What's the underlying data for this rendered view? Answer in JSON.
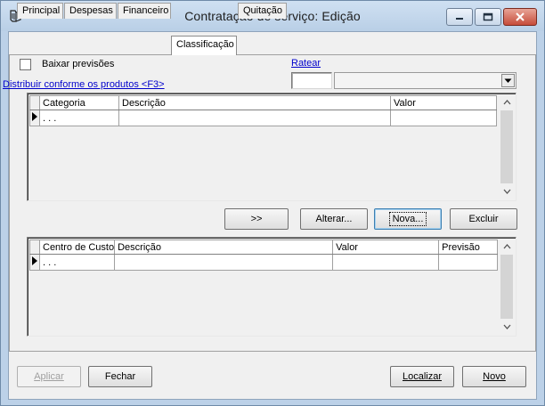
{
  "window": {
    "title": "Contratação de serviço: Edição"
  },
  "tabs": [
    {
      "label": "Principal",
      "active": false
    },
    {
      "label": "Despesas",
      "active": false
    },
    {
      "label": "Financeiro",
      "active": false
    },
    {
      "label": "Classificação",
      "active": true
    },
    {
      "label": "Quitação",
      "active": false
    }
  ],
  "classificacao": {
    "baixar_previsoes_label": "Baixar previsões",
    "baixar_previsoes_checked": false,
    "ratear_link": "Ratear",
    "distribuir_link": "Distribuir conforme os produtos <F3>",
    "ratear_value": "",
    "ratear_combo_value": ""
  },
  "grid1": {
    "columns": [
      "Categoria",
      "Descrição",
      "Valor"
    ],
    "rows": [
      [
        ". . .",
        "",
        ""
      ]
    ]
  },
  "mid_buttons": {
    "transfer": ">>",
    "alterar": "Alterar...",
    "nova": "Nova...",
    "excluir": "Excluir"
  },
  "grid2": {
    "columns": [
      "Centro de Custo",
      "Descrição",
      "Valor",
      "Previsão"
    ],
    "rows": [
      [
        ". . .",
        "",
        "",
        ""
      ]
    ]
  },
  "footer": {
    "aplicar": "Aplicar",
    "fechar": "Fechar",
    "localizar": "Localizar",
    "novo": "Novo"
  },
  "icons": {
    "app": "document-icon",
    "minimize": "minimize-icon",
    "maximize": "maximize-icon",
    "close": "close-icon"
  },
  "colors": {
    "titlebar": "#bcd1e8",
    "link": "#0000cc",
    "close_button": "#c64c3a"
  }
}
